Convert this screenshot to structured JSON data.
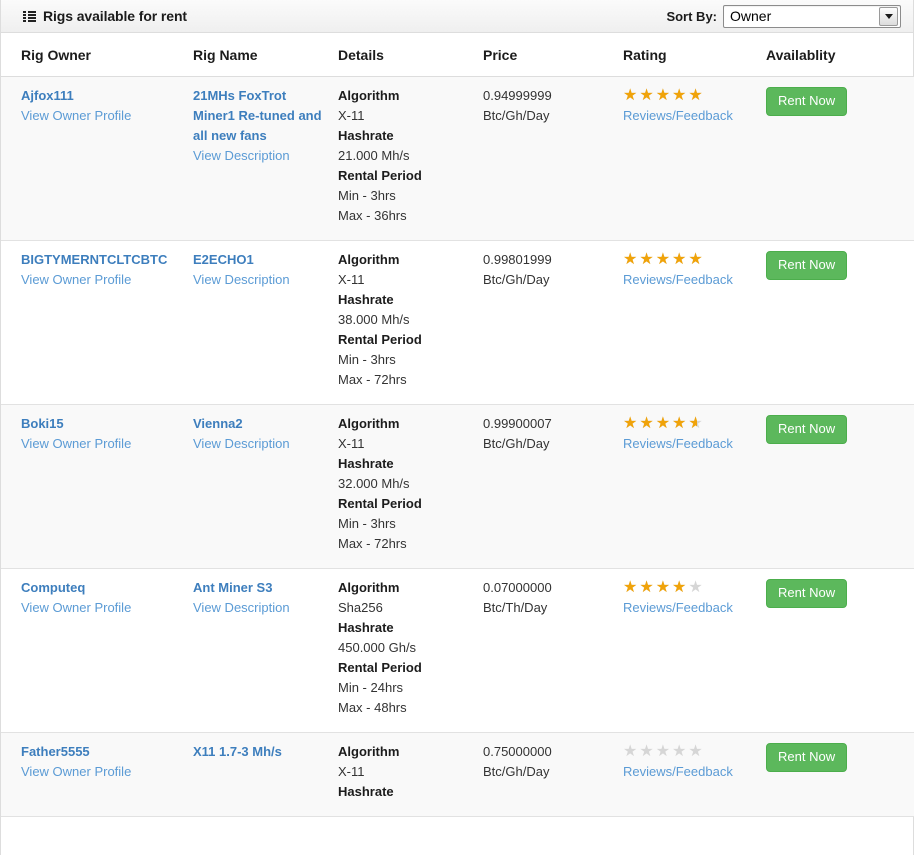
{
  "header": {
    "title": "Rigs available for rent",
    "icon": "list-icon",
    "sort_label": "Sort By:",
    "sort_value": "Owner",
    "sort_options": [
      "Owner"
    ]
  },
  "table": {
    "columns": [
      "Rig Owner",
      "Rig Name",
      "Details",
      "Price",
      "Rating",
      "Availablity"
    ],
    "labels": {
      "view_owner_profile": "View Owner Profile",
      "view_description": "View Description",
      "reviews_feedback": "Reviews/Feedback",
      "rent_now": "Rent Now",
      "algorithm": "Algorithm",
      "hashrate": "Hashrate",
      "rental_period": "Rental Period"
    },
    "rows": [
      {
        "owner": "Ajfox111",
        "owner_link": "View Owner Profile",
        "rig_name": "21MHs FoxTrot Miner1 Re-tuned and all new fans",
        "description_link": "View Description",
        "algorithm": "X-11",
        "hashrate": "21.000 Mh/s",
        "rental_min": "Min - 3hrs",
        "rental_max": "Max - 36hrs",
        "price": "0.94999999",
        "price_unit": "Btc/Gh/Day",
        "rating": 5,
        "reviews_link": "Reviews/Feedback",
        "action": "Rent Now"
      },
      {
        "owner": "BIGTYMERNTCLTCBTC",
        "owner_link": "View Owner Profile",
        "rig_name": "E2ECHO1",
        "description_link": "View Description",
        "algorithm": "X-11",
        "hashrate": "38.000 Mh/s",
        "rental_min": "Min - 3hrs",
        "rental_max": "Max - 72hrs",
        "price": "0.99801999",
        "price_unit": "Btc/Gh/Day",
        "rating": 5,
        "reviews_link": "Reviews/Feedback",
        "action": "Rent Now"
      },
      {
        "owner": "Boki15",
        "owner_link": "View Owner Profile",
        "rig_name": "Vienna2",
        "description_link": "View Description",
        "algorithm": "X-11",
        "hashrate": "32.000 Mh/s",
        "rental_min": "Min - 3hrs",
        "rental_max": "Max - 72hrs",
        "price": "0.99900007",
        "price_unit": "Btc/Gh/Day",
        "rating": 4.5,
        "reviews_link": "Reviews/Feedback",
        "action": "Rent Now"
      },
      {
        "owner": "Computeq",
        "owner_link": "View Owner Profile",
        "rig_name": "Ant Miner S3",
        "description_link": "View Description",
        "algorithm": "Sha256",
        "hashrate": "450.000 Gh/s",
        "rental_min": "Min - 24hrs",
        "rental_max": "Max - 48hrs",
        "price": "0.07000000",
        "price_unit": "Btc/Th/Day",
        "rating": 4,
        "reviews_link": "Reviews/Feedback",
        "action": "Rent Now"
      },
      {
        "owner": "Father5555",
        "owner_link": "View Owner Profile",
        "rig_name": "X11 1.7-3 Mh/s",
        "description_link": "",
        "algorithm": "X-11",
        "hashrate": "",
        "rental_min": "",
        "rental_max": "",
        "price": "0.75000000",
        "price_unit": "Btc/Gh/Day",
        "rating": 0,
        "reviews_link": "Reviews/Feedback",
        "action": "Rent Now"
      }
    ]
  },
  "colors": {
    "accent_link": "#3d7ebd",
    "sub_link": "#5b9bd5",
    "star_filled": "#f0a30a",
    "star_empty": "#d6d6d6",
    "button_green": "#5cb85c",
    "row_alt": "#f9f9f9"
  }
}
